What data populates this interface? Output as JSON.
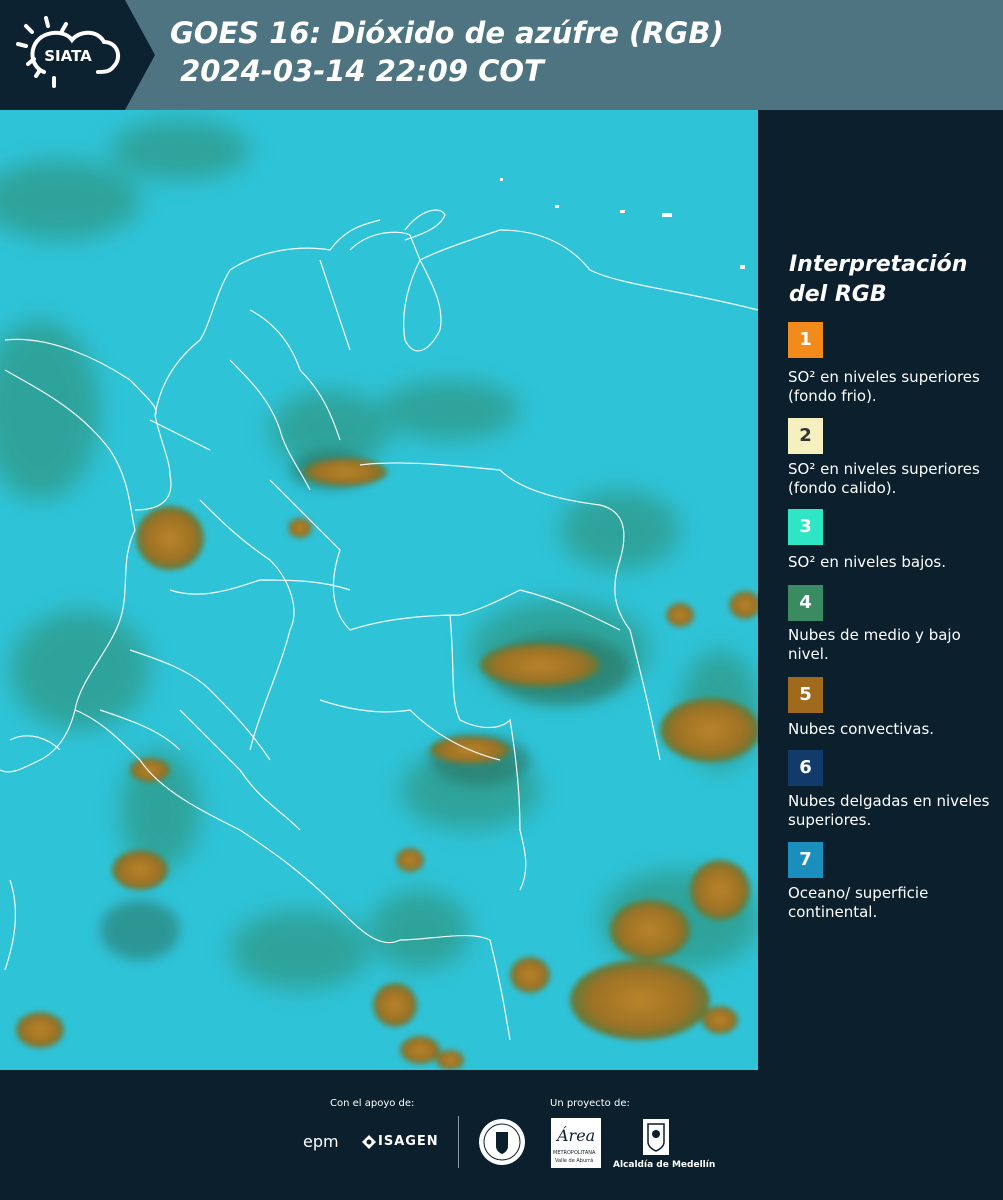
{
  "header": {
    "logo_text": "SIATA",
    "title_line1": "GOES 16: Dióxido de azúfre (RGB)",
    "title_line2": " 2024-03-14 22:09 COT"
  },
  "legend": {
    "title": "Interpretación del RGB",
    "items": [
      {
        "number": "1",
        "color": "#f28a1c",
        "text": "SO² en niveles superiores (fondo frio)."
      },
      {
        "number": "2",
        "color": "#f6f0c0",
        "text": "SO² en niveles superiores (fondo calido)."
      },
      {
        "number": "3",
        "color": "#2ee6c6",
        "text": "SO² en niveles bajos."
      },
      {
        "number": "4",
        "color": "#3a8a62",
        "text": "Nubes de medio y bajo nivel."
      },
      {
        "number": "5",
        "color": "#a06a1c",
        "text": "Nubes convectivas."
      },
      {
        "number": "6",
        "color": "#123a6a",
        "text": "Nubes delgadas en niveles superiores."
      },
      {
        "number": "7",
        "color": "#1a8fbd",
        "text": "Oceano/ superficie continental."
      }
    ]
  },
  "footer": {
    "support_label": "Con el apoyo de:",
    "project_label": "Un proyecto de:",
    "sponsor_epm": "epm",
    "sponsor_isagen": "ISAGEN",
    "area_logo_text": "Área",
    "area_subtext1": "METROPOLITANA",
    "area_subtext2": "Valle de Aburrá",
    "alcaldia": "Alcaldía de Medellín"
  }
}
